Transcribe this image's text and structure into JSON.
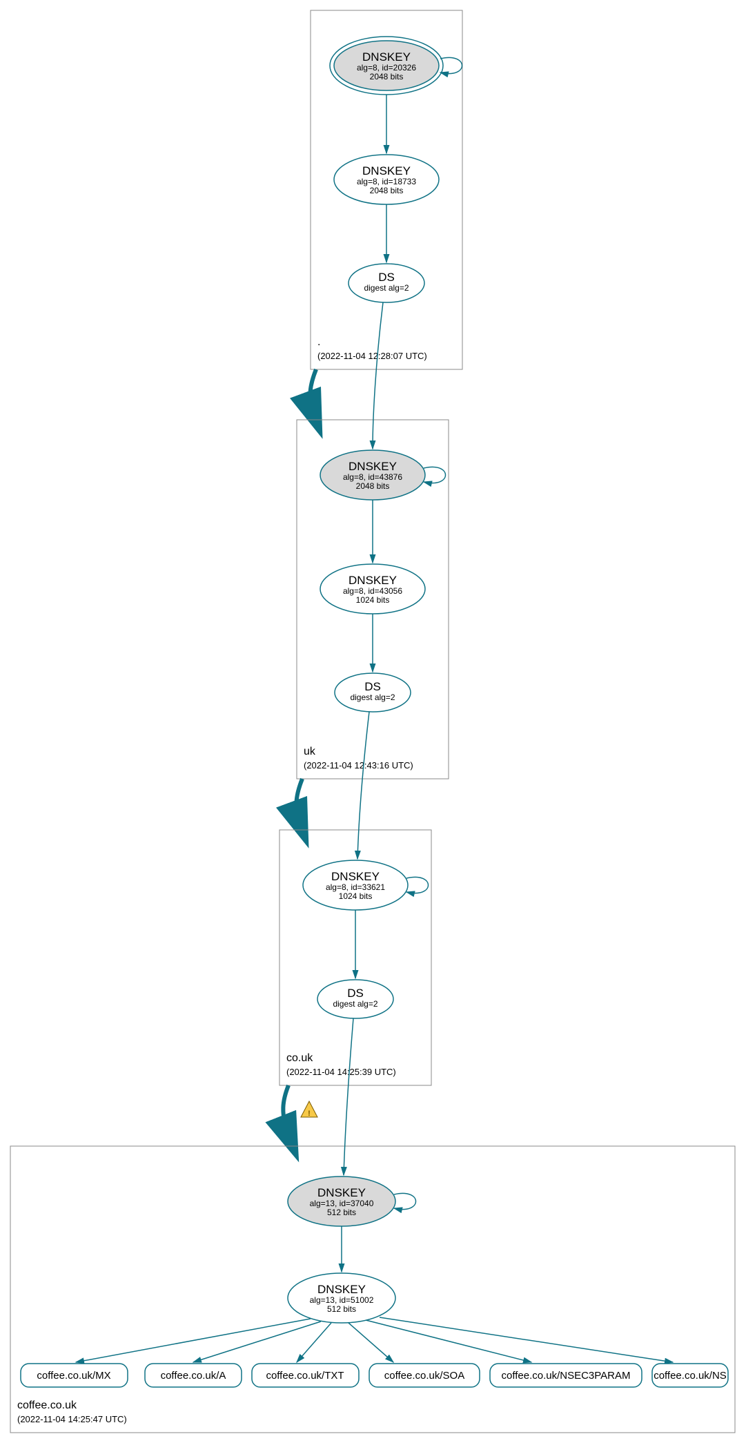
{
  "colors": {
    "stroke": "#0f7285",
    "ksk_fill": "#d9d9d9",
    "zone_border": "#888888"
  },
  "zones": [
    {
      "name": ".",
      "timestamp": "(2022-11-04 12:28:07 UTC)"
    },
    {
      "name": "uk",
      "timestamp": "(2022-11-04 12:43:16 UTC)"
    },
    {
      "name": "co.uk",
      "timestamp": "(2022-11-04 14:25:39 UTC)"
    },
    {
      "name": "coffee.co.uk",
      "timestamp": "(2022-11-04 14:25:47 UTC)"
    }
  ],
  "nodes": {
    "root_ksk": {
      "title": "DNSKEY",
      "line2": "alg=8, id=20326",
      "line3": "2048 bits"
    },
    "root_zsk": {
      "title": "DNSKEY",
      "line2": "alg=8, id=18733",
      "line3": "2048 bits"
    },
    "root_ds": {
      "title": "DS",
      "line2": "digest alg=2",
      "line3": ""
    },
    "uk_ksk": {
      "title": "DNSKEY",
      "line2": "alg=8, id=43876",
      "line3": "2048 bits"
    },
    "uk_zsk": {
      "title": "DNSKEY",
      "line2": "alg=8, id=43056",
      "line3": "1024 bits"
    },
    "uk_ds": {
      "title": "DS",
      "line2": "digest alg=2",
      "line3": ""
    },
    "couk_ksk": {
      "title": "DNSKEY",
      "line2": "alg=8, id=33621",
      "line3": "1024 bits"
    },
    "couk_ds": {
      "title": "DS",
      "line2": "digest alg=2",
      "line3": ""
    },
    "coffee_ksk": {
      "title": "DNSKEY",
      "line2": "alg=13, id=37040",
      "line3": "512 bits"
    },
    "coffee_zsk": {
      "title": "DNSKEY",
      "line2": "alg=13, id=51002",
      "line3": "512 bits"
    }
  },
  "rrsets": [
    "coffee.co.uk/MX",
    "coffee.co.uk/A",
    "coffee.co.uk/TXT",
    "coffee.co.uk/SOA",
    "coffee.co.uk/NSEC3PARAM",
    "coffee.co.uk/NS"
  ],
  "warnings": {
    "couk_to_coffee": true
  }
}
